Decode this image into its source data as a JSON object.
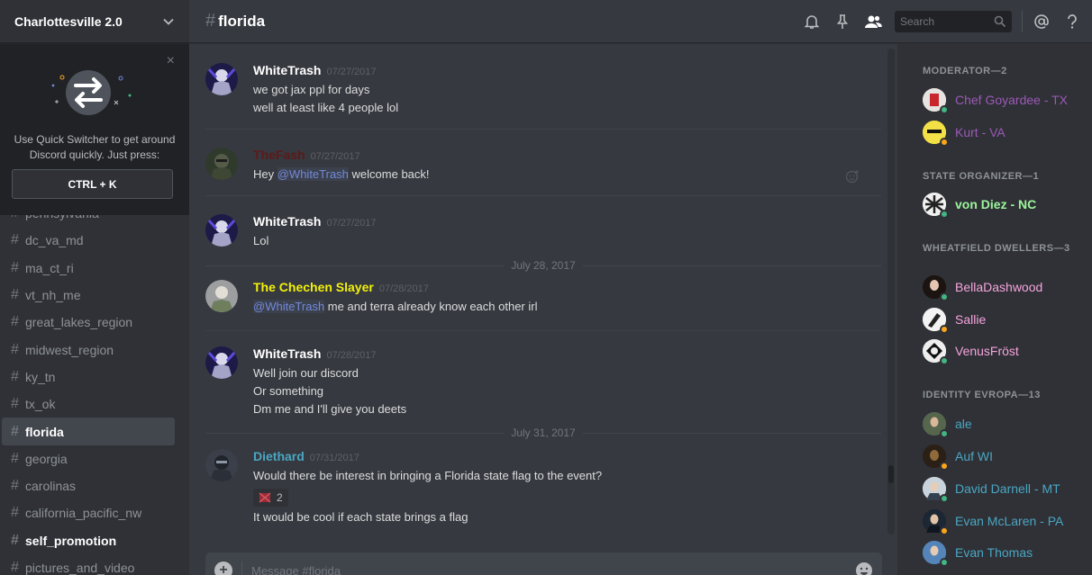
{
  "guild": {
    "name": "Charlottesville 2.0"
  },
  "quick_switcher": {
    "text_line1": "Use Quick Switcher to get around",
    "text_line2": "Discord quickly. Just press:",
    "shortcut": "CTRL + K",
    "close_glyph": "×"
  },
  "channels": [
    {
      "name": "pennsylvania",
      "style": "normal"
    },
    {
      "name": "dc_va_md",
      "style": "normal"
    },
    {
      "name": "ma_ct_ri",
      "style": "normal"
    },
    {
      "name": "vt_nh_me",
      "style": "normal"
    },
    {
      "name": "great_lakes_region",
      "style": "normal"
    },
    {
      "name": "midwest_region",
      "style": "normal"
    },
    {
      "name": "ky_tn",
      "style": "normal"
    },
    {
      "name": "tx_ok",
      "style": "normal"
    },
    {
      "name": "florida",
      "style": "active"
    },
    {
      "name": "georgia",
      "style": "normal"
    },
    {
      "name": "carolinas",
      "style": "normal"
    },
    {
      "name": "california_pacific_nw",
      "style": "normal"
    },
    {
      "name": "self_promotion",
      "style": "bold"
    },
    {
      "name": "pictures_and_video",
      "style": "normal"
    }
  ],
  "hash_glyph": "#",
  "header": {
    "channel": "florida",
    "search_placeholder": "Search"
  },
  "messages": [
    {
      "author": "WhiteTrash",
      "color": "#ffffff",
      "time": "07/27/2017",
      "lines": [
        "we got jax ppl for days",
        "well at least like 4 people lol"
      ]
    },
    {
      "author": "TheFash",
      "color": "#5c1a1a",
      "time": "07/27/2017",
      "mention": "@WhiteTrash",
      "rest": " welcome back!",
      "prefix": "Hey "
    },
    {
      "author": "WhiteTrash",
      "color": "#ffffff",
      "time": "07/27/2017",
      "lines": [
        "Lol"
      ]
    },
    {
      "author": "The Chechen Slayer",
      "color": "#f1f10b",
      "time": "07/28/2017",
      "mention": "@WhiteTrash",
      "rest": " me and terra already know each other irl"
    },
    {
      "author": "WhiteTrash",
      "color": "#ffffff",
      "time": "07/28/2017",
      "lines": [
        "Well join our discord",
        "Or something",
        "Dm me and I'll give you deets"
      ]
    },
    {
      "author": "Diethard",
      "color": "#4aa6c3",
      "time": "07/31/2017",
      "lines": [
        "Would there be interest in bringing a Florida state flag to the event?",
        "It would be cool if each state brings a flag"
      ],
      "reaction_count": "2"
    }
  ],
  "date_dividers": [
    "July 28, 2017",
    "July 31, 2017"
  ],
  "composer": {
    "placeholder": "Message #florida"
  },
  "member_groups": [
    {
      "title": "MODERATOR—2"
    },
    {
      "title": "STATE ORGANIZER—1"
    },
    {
      "title": "WHEATFIELD DWELLERS—3"
    },
    {
      "title": "IDENTITY EVROPA—13"
    }
  ],
  "members": [
    {
      "name": "Chef Goyardee - TX",
      "color": "#9b59b6",
      "status": "#43b581"
    },
    {
      "name": "Kurt - VA",
      "color": "#9b59b6",
      "status": "#faa61a"
    },
    {
      "name": "von Diez - NC",
      "color": "#9cf59c",
      "status": "#43b581"
    },
    {
      "name": "BellaDashwood",
      "color": "#f5a3dc",
      "status": "#43b581"
    },
    {
      "name": "Sallie",
      "color": "#f5a3dc",
      "status": "#faa61a"
    },
    {
      "name": "VenusFröst",
      "color": "#f5a3dc",
      "status": "#43b581"
    },
    {
      "name": "ale",
      "color": "#4aa6c3",
      "status": "#43b581"
    },
    {
      "name": "Auf WI",
      "color": "#4aa6c3",
      "status": "#faa61a"
    },
    {
      "name": "David Darnell - MT",
      "color": "#4aa6c3",
      "status": "#43b581"
    },
    {
      "name": "Evan McLaren - PA",
      "color": "#4aa6c3",
      "status": "#faa61a"
    },
    {
      "name": "Evan Thomas",
      "color": "#4aa6c3",
      "status": "#43b581"
    }
  ],
  "icons": [
    "chevron-down-icon",
    "close-icon",
    "bell-icon",
    "pin-icon",
    "members-icon",
    "search-icon",
    "mention-icon",
    "help-icon",
    "add-icon",
    "emoji-icon",
    "reaction-icon"
  ]
}
